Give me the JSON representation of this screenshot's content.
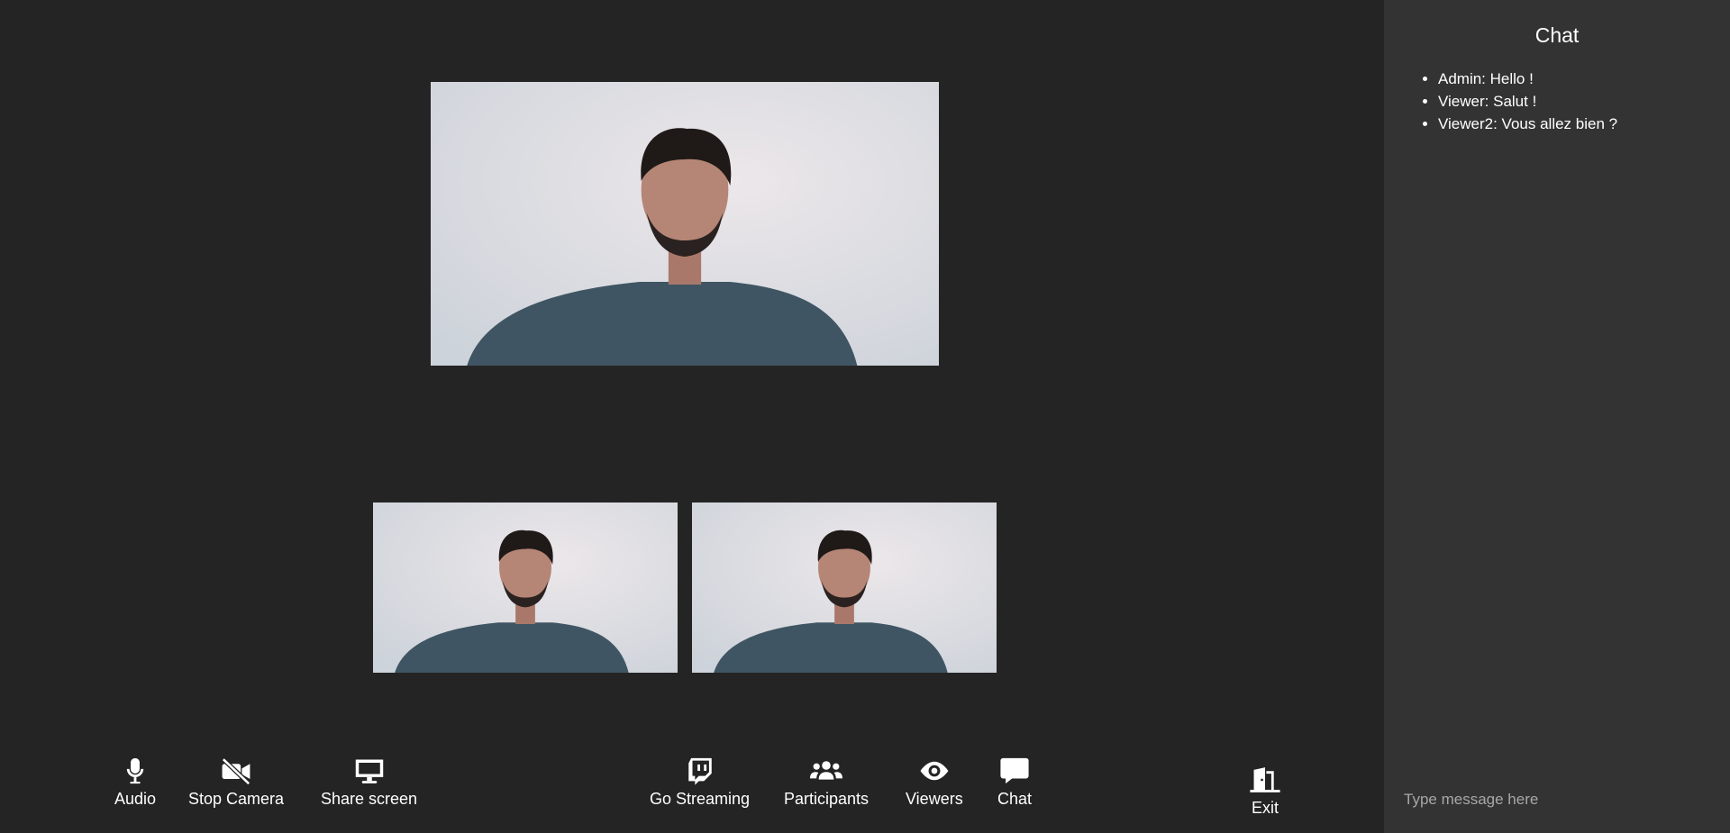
{
  "colors": {
    "background": "#242424",
    "chat_panel": "#333333",
    "icon": "#ffffff",
    "placeholder": "#a7a7a7"
  },
  "video": {
    "tiles": [
      "main-webcam",
      "participant-webcam-1",
      "participant-webcam-2"
    ]
  },
  "controls": {
    "audio": {
      "label": "Audio",
      "icon": "microphone-icon"
    },
    "camera": {
      "label": "Stop Camera",
      "icon": "video-slash-icon"
    },
    "share": {
      "label": "Share screen",
      "icon": "desktop-icon"
    },
    "stream": {
      "label": "Go Streaming",
      "icon": "twitch-icon"
    },
    "participants": {
      "label": "Participants",
      "icon": "users-icon"
    },
    "viewers": {
      "label": "Viewers",
      "icon": "eye-icon"
    },
    "chat": {
      "label": "Chat",
      "icon": "comment-icon"
    },
    "exit": {
      "label": "Exit",
      "icon": "door-open-icon"
    }
  },
  "chat": {
    "title": "Chat",
    "messages": [
      "Admin: Hello !",
      "Viewer: Salut !",
      "Viewer2: Vous allez bien ?"
    ],
    "input_placeholder": "Type message here"
  }
}
